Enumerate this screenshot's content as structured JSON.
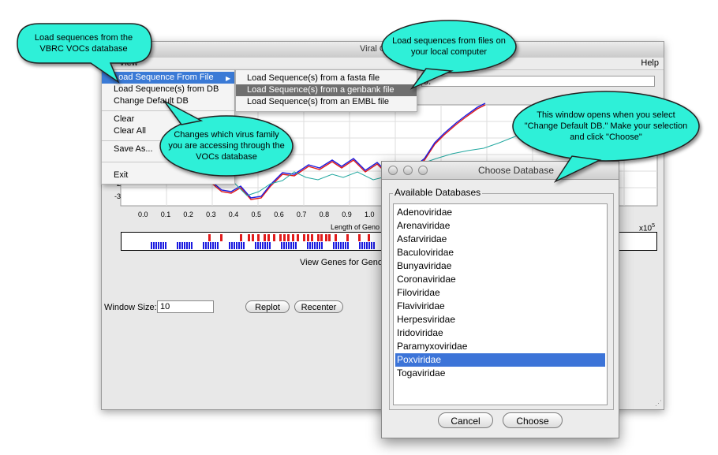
{
  "main_window": {
    "title": "Viral Graphi",
    "menus": {
      "view": "View",
      "help": "Help"
    },
    "info_field": "9.",
    "plot": {
      "x_ticks": [
        "0.0",
        "0.1",
        "0.2",
        "0.3",
        "0.4",
        "0.5",
        "0.6",
        "0.7",
        "0.8",
        "0.9",
        "1.0"
      ],
      "y_ticks": [
        "-2",
        "-3"
      ],
      "x_label": "Length of Geno",
      "exponent": "x10",
      "exponent_power": "5"
    },
    "view_genes_label": "View Genes for Genor",
    "window_size_label": "Window Size:",
    "window_size_value": "10",
    "replot_label": "Replot",
    "recenter_label": "Recenter"
  },
  "file_menu": {
    "items": [
      "Load Sequence From File",
      "Load Sequence(s) from DB",
      "Change Default DB",
      "Clear",
      "Clear All",
      "Save As...",
      "Exit"
    ],
    "submenu_arrow": "▶"
  },
  "sub_menu": {
    "items": [
      "Load Sequence(s) from a fasta file",
      "Load Sequence(s) from a genbank file",
      "Load Sequence(s) from an EMBL file"
    ]
  },
  "dialog": {
    "title": "Choose Database",
    "group_label": "Available Databases",
    "databases": [
      "Adenoviridae",
      "Arenaviridae",
      "Asfarviridae",
      "Baculoviridae",
      "Bunyaviridae",
      "Coronaviridae",
      "Filoviridae",
      "Flaviviridae",
      "Herpesviridae",
      "Iridoviridae",
      "Paramyxoviridae",
      "Poxviridae",
      "Togaviridae"
    ],
    "selected": "Poxviridae",
    "cancel_label": "Cancel",
    "choose_label": "Choose"
  },
  "callouts": {
    "vbrc": [
      "Load sequences from the",
      "VBRC VOCs database"
    ],
    "local": [
      "Load sequences from files on",
      "your local computer"
    ],
    "family": [
      "Changes which virus family",
      "you are accessing through the",
      "VOCs database"
    ],
    "window": [
      "This window opens when you select",
      "\"Change Default DB.\" Make your selection",
      "and click \"Choose\""
    ]
  },
  "colors": {
    "callout_fill": "#2ff0d8",
    "selection_blue": "#3c74d8",
    "series_red": "#e01b1b",
    "series_blue": "#1b1be0",
    "series_teal": "#22a8a0"
  }
}
